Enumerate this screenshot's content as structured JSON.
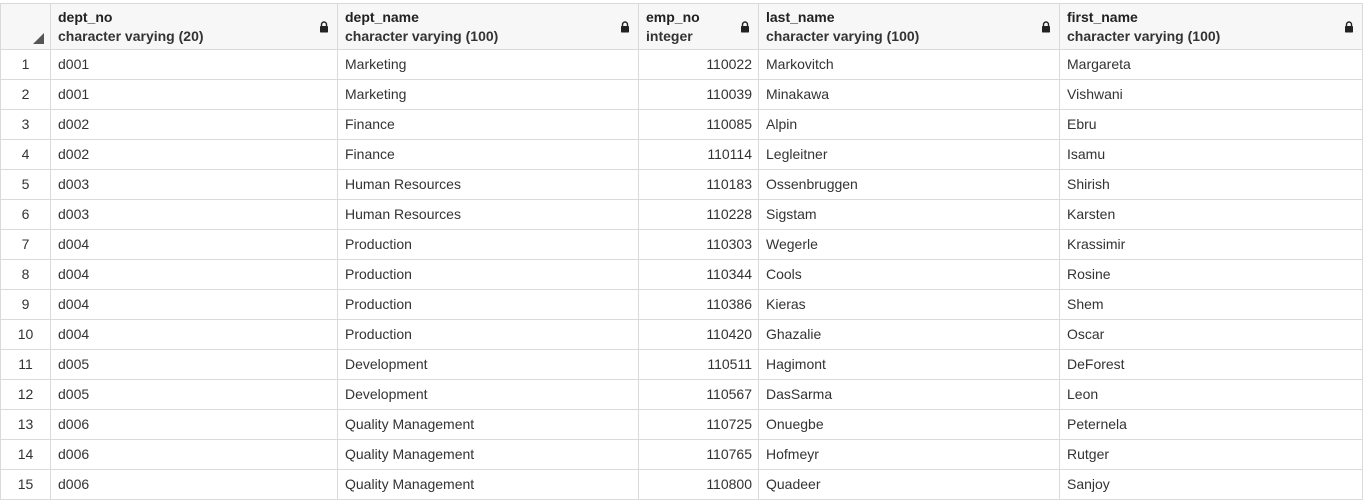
{
  "columns": [
    {
      "name": "dept_no",
      "type": "character varying (20)"
    },
    {
      "name": "dept_name",
      "type": "character varying (100)"
    },
    {
      "name": "emp_no",
      "type": "integer"
    },
    {
      "name": "last_name",
      "type": "character varying (100)"
    },
    {
      "name": "first_name",
      "type": "character varying (100)"
    }
  ],
  "rows": [
    {
      "n": "1",
      "dept_no": "d001",
      "dept_name": "Marketing",
      "emp_no": "110022",
      "last_name": "Markovitch",
      "first_name": "Margareta"
    },
    {
      "n": "2",
      "dept_no": "d001",
      "dept_name": "Marketing",
      "emp_no": "110039",
      "last_name": "Minakawa",
      "first_name": "Vishwani"
    },
    {
      "n": "3",
      "dept_no": "d002",
      "dept_name": "Finance",
      "emp_no": "110085",
      "last_name": "Alpin",
      "first_name": "Ebru"
    },
    {
      "n": "4",
      "dept_no": "d002",
      "dept_name": "Finance",
      "emp_no": "110114",
      "last_name": "Legleitner",
      "first_name": "Isamu"
    },
    {
      "n": "5",
      "dept_no": "d003",
      "dept_name": "Human Resources",
      "emp_no": "110183",
      "last_name": "Ossenbruggen",
      "first_name": "Shirish"
    },
    {
      "n": "6",
      "dept_no": "d003",
      "dept_name": "Human Resources",
      "emp_no": "110228",
      "last_name": "Sigstam",
      "first_name": "Karsten"
    },
    {
      "n": "7",
      "dept_no": "d004",
      "dept_name": "Production",
      "emp_no": "110303",
      "last_name": "Wegerle",
      "first_name": "Krassimir"
    },
    {
      "n": "8",
      "dept_no": "d004",
      "dept_name": "Production",
      "emp_no": "110344",
      "last_name": "Cools",
      "first_name": "Rosine"
    },
    {
      "n": "9",
      "dept_no": "d004",
      "dept_name": "Production",
      "emp_no": "110386",
      "last_name": "Kieras",
      "first_name": "Shem"
    },
    {
      "n": "10",
      "dept_no": "d004",
      "dept_name": "Production",
      "emp_no": "110420",
      "last_name": "Ghazalie",
      "first_name": "Oscar"
    },
    {
      "n": "11",
      "dept_no": "d005",
      "dept_name": "Development",
      "emp_no": "110511",
      "last_name": "Hagimont",
      "first_name": "DeForest"
    },
    {
      "n": "12",
      "dept_no": "d005",
      "dept_name": "Development",
      "emp_no": "110567",
      "last_name": "DasSarma",
      "first_name": "Leon"
    },
    {
      "n": "13",
      "dept_no": "d006",
      "dept_name": "Quality Management",
      "emp_no": "110725",
      "last_name": "Onuegbe",
      "first_name": "Peternela"
    },
    {
      "n": "14",
      "dept_no": "d006",
      "dept_name": "Quality Management",
      "emp_no": "110765",
      "last_name": "Hofmeyr",
      "first_name": "Rutger"
    },
    {
      "n": "15",
      "dept_no": "d006",
      "dept_name": "Quality Management",
      "emp_no": "110800",
      "last_name": "Quadeer",
      "first_name": "Sanjoy"
    }
  ],
  "icons": {
    "lock": "lock-icon",
    "select_all": "select-all-corner-icon"
  },
  "colors": {
    "header_bg": "#f7f7f7",
    "grid_line": "#dadada",
    "text": "#333333"
  }
}
